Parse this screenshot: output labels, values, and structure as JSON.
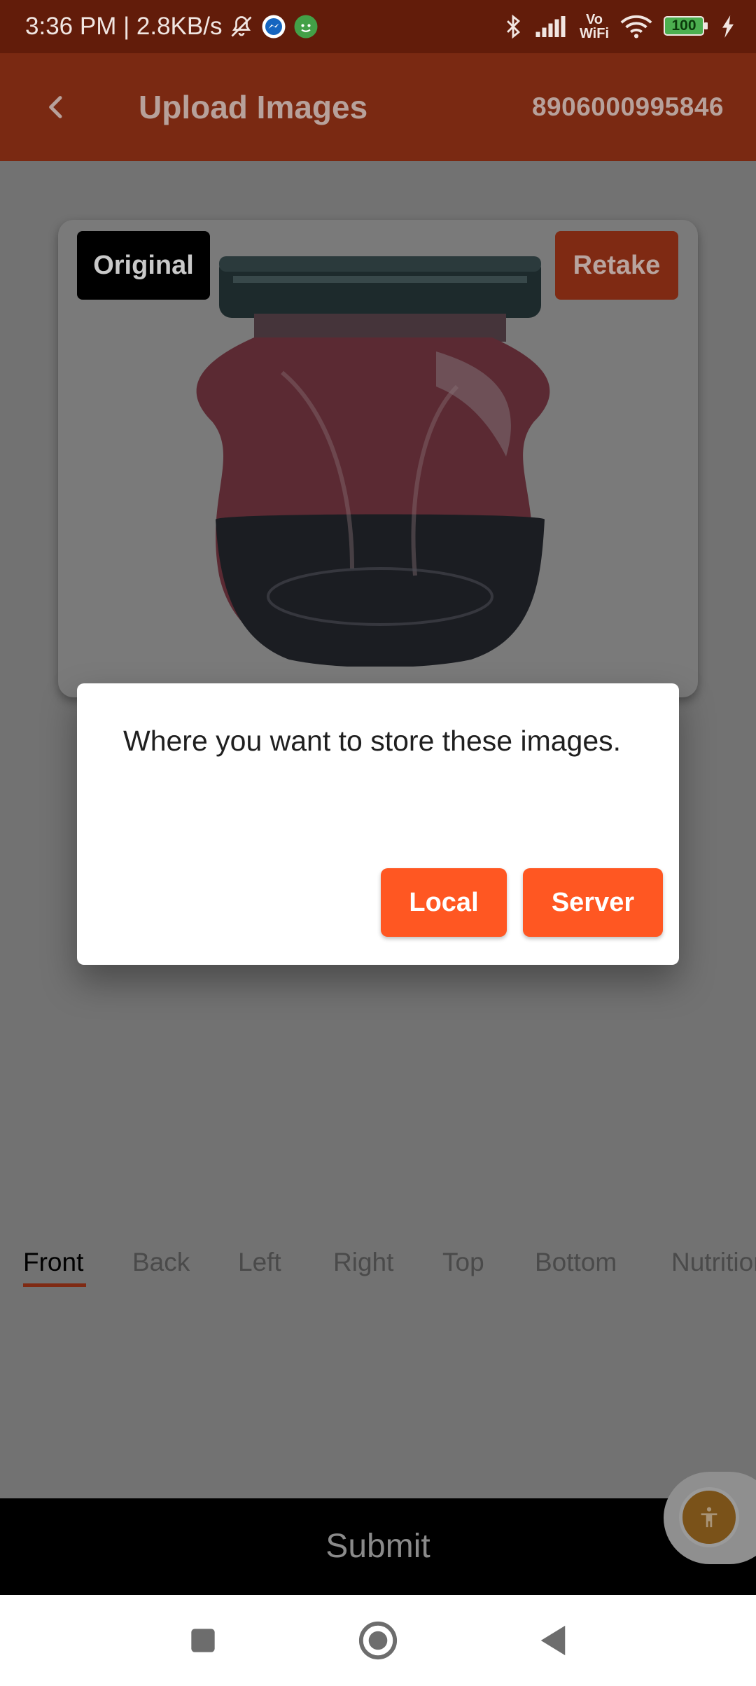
{
  "status_bar": {
    "time_speed": "3:36 PM | 2.8KB/s",
    "battery": "100",
    "vowifi_top": "Vo",
    "vowifi_bottom": "WiFi",
    "icons": [
      "bell-off-icon",
      "messenger-icon",
      "android-face-icon",
      "bluetooth-icon",
      "signal-icon",
      "vowifi-icon",
      "wifi-icon",
      "battery-icon",
      "charging-icon"
    ]
  },
  "header": {
    "title": "Upload Images",
    "barcode": "8906000995846"
  },
  "image_card": {
    "original_label": "Original",
    "retake_label": "Retake"
  },
  "dialog": {
    "message": "Where you want to store these images.",
    "local_label": "Local",
    "server_label": "Server",
    "button_color": "#ff5722"
  },
  "tabs": [
    {
      "label": "Front",
      "active": true
    },
    {
      "label": "Back",
      "active": false
    },
    {
      "label": "Left",
      "active": false
    },
    {
      "label": "Right",
      "active": false
    },
    {
      "label": "Top",
      "active": false
    },
    {
      "label": "Bottom",
      "active": false
    },
    {
      "label": "Nutrition",
      "active": false
    }
  ],
  "footer": {
    "submit_label": "Submit"
  },
  "colors": {
    "status_bar": "#621c0a",
    "app_bar": "#7a2912",
    "accent": "#ff5722",
    "scrim": "#727272"
  }
}
